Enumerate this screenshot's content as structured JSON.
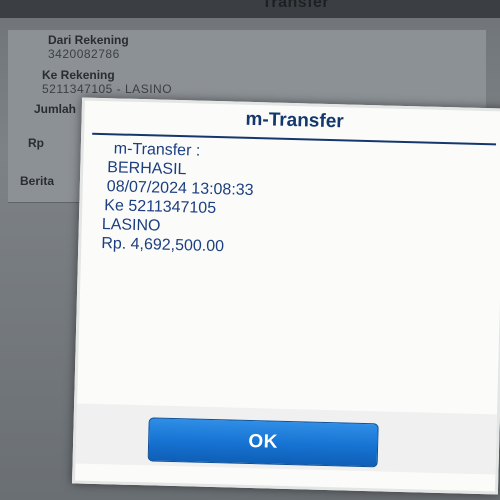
{
  "background": {
    "header_title": "Transfer",
    "fields": [
      {
        "label": "Dari Rekening",
        "value": "3420082786"
      },
      {
        "label": "Ke Rekening",
        "value": "5211347105 - LASINO"
      },
      {
        "label": "Jumlah",
        "value": ""
      },
      {
        "label": "Rp",
        "value": ""
      },
      {
        "label": "Berita",
        "value": ""
      }
    ]
  },
  "dialog": {
    "title": "m-Transfer",
    "message_lines": [
      "m-Transfer :",
      "BERHASIL",
      "08/07/2024 13:08:33",
      "Ke 5211347105",
      "LASINO",
      "Rp. 4,692,500.00"
    ],
    "ok_label": "OK"
  }
}
